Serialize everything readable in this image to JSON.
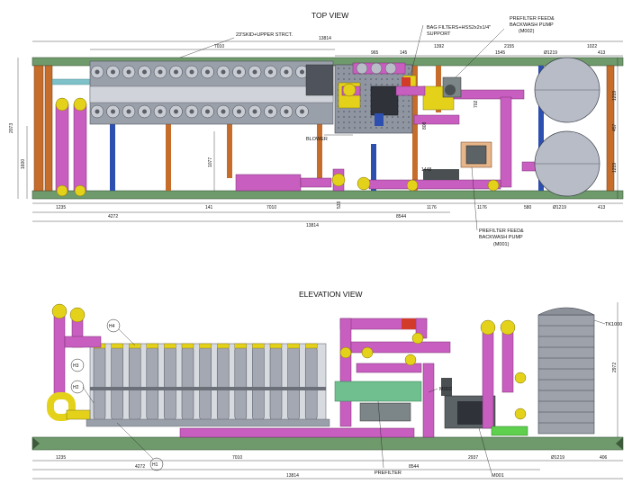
{
  "top_view": {
    "title": "TOP VIEW",
    "labels": {
      "skid": "23'SKID+UPPER STRCT.",
      "bag_filters": "BAG FILTERS+HSS2x2x1/4\"",
      "support": "SUPPORT",
      "prefilter_pump_m002_a": "PREFILTER FEED&",
      "prefilter_pump_m002_b": "BACKWASH PUMP",
      "prefilter_pump_m002_c": "(M002)",
      "blower": "BLOWER",
      "prefilter_pump_m001_a": "PREFILTER FEED&",
      "prefilter_pump_m001_b": "BACKWASH PUMP",
      "prefilter_pump_m001_c": "(M001)"
    },
    "dims": {
      "overall_top": "13814",
      "d7010_top": "7010",
      "d965": "965",
      "d145": "145",
      "d1392": "1392",
      "d2155": "2155",
      "d1022": "1022",
      "d1545": "1545",
      "d1219_top": "Ø1219",
      "d413_top": "413",
      "d2073": "2073",
      "d1600": "1600",
      "d1077": "1077",
      "d808": "808",
      "d702": "702",
      "d1448": "1448",
      "d1219_r1": "1219",
      "d457": "457",
      "d1219_r2": "1219",
      "d1235": "1235",
      "d4272": "4272",
      "d141": "141",
      "d7010_bot": "7010",
      "d533": "533",
      "d1176_a": "1176",
      "d1176_b": "1176",
      "d580": "580",
      "d1219_bot": "Ø1219",
      "d413_bot": "413",
      "d8544": "8544",
      "overall_bot": "13814"
    }
  },
  "elevation_view": {
    "title": "ELEVATION VIEW",
    "labels": {
      "h1": "H1",
      "h2": "H2",
      "h3": "H3",
      "h4": "H4",
      "m002": "M002",
      "tk1000": "TK1000",
      "prefilter": "PREFILTER",
      "m001": "M001"
    },
    "dims": {
      "d2972": "2972",
      "d1235": "1235",
      "d4272": "4272",
      "d7010": "7010",
      "d2937": "2937",
      "d1219": "Ø1219",
      "d406": "406",
      "d8544": "8544",
      "overall": "13814"
    }
  },
  "colors": {
    "pipe": "#c85fc0",
    "pipe_dark": "#9b3f93",
    "frame": "#6f9a6c",
    "frame_dark": "#4e744c",
    "steel": "#b8bcc6",
    "steel_dark": "#7c808a",
    "yellow": "#e4d21a",
    "orange": "#c76d2c",
    "blue": "#2d4fb0",
    "red": "#d23a2a",
    "pump": "#7c8588"
  }
}
